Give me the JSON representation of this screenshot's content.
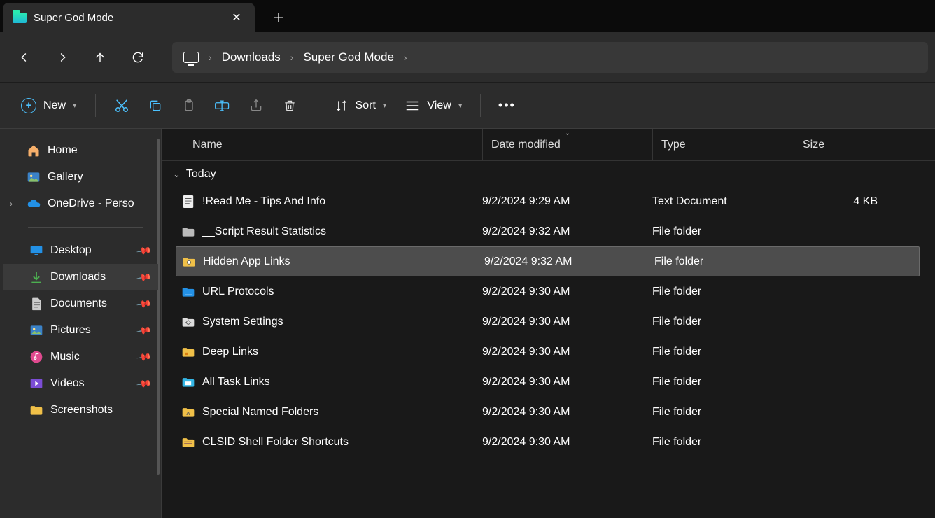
{
  "tab": {
    "title": "Super God Mode"
  },
  "breadcrumb": [
    "Downloads",
    "Super God Mode"
  ],
  "toolbar": {
    "new": "New",
    "sort": "Sort",
    "view": "View"
  },
  "sidebar": {
    "top": [
      {
        "label": "Home",
        "icon": "home"
      },
      {
        "label": "Gallery",
        "icon": "gallery"
      },
      {
        "label": "OneDrive - Perso",
        "icon": "onedrive",
        "expandable": true
      }
    ],
    "quick": [
      {
        "label": "Desktop",
        "icon": "desktop",
        "pinned": true
      },
      {
        "label": "Downloads",
        "icon": "downloads",
        "pinned": true,
        "active": true
      },
      {
        "label": "Documents",
        "icon": "documents",
        "pinned": true
      },
      {
        "label": "Pictures",
        "icon": "pictures",
        "pinned": true
      },
      {
        "label": "Music",
        "icon": "music",
        "pinned": true
      },
      {
        "label": "Videos",
        "icon": "videos",
        "pinned": true
      },
      {
        "label": "Screenshots",
        "icon": "folder"
      }
    ]
  },
  "columns": {
    "name": "Name",
    "date": "Date modified",
    "type": "Type",
    "size": "Size"
  },
  "group": "Today",
  "files": [
    {
      "name": "!Read Me - Tips And Info",
      "date": "9/2/2024 9:29 AM",
      "type": "Text Document",
      "size": "4 KB",
      "icon": "txt"
    },
    {
      "name": "__Script Result Statistics",
      "date": "9/2/2024 9:32 AM",
      "type": "File folder",
      "size": "",
      "icon": "folder-gray"
    },
    {
      "name": "Hidden App Links",
      "date": "9/2/2024 9:32 AM",
      "type": "File folder",
      "size": "",
      "icon": "folder-photo",
      "selected": true
    },
    {
      "name": "URL Protocols",
      "date": "9/2/2024 9:30 AM",
      "type": "File folder",
      "size": "",
      "icon": "folder-blue"
    },
    {
      "name": "System Settings",
      "date": "9/2/2024 9:30 AM",
      "type": "File folder",
      "size": "",
      "icon": "folder-gear"
    },
    {
      "name": "Deep Links",
      "date": "9/2/2024 9:30 AM",
      "type": "File folder",
      "size": "",
      "icon": "folder-yellow"
    },
    {
      "name": "All Task Links",
      "date": "9/2/2024 9:30 AM",
      "type": "File folder",
      "size": "",
      "icon": "folder-cyan"
    },
    {
      "name": "Special Named Folders",
      "date": "9/2/2024 9:30 AM",
      "type": "File folder",
      "size": "",
      "icon": "folder-a"
    },
    {
      "name": "CLSID Shell Folder Shortcuts",
      "date": "9/2/2024 9:30 AM",
      "type": "File folder",
      "size": "",
      "icon": "folder-stripe"
    }
  ]
}
